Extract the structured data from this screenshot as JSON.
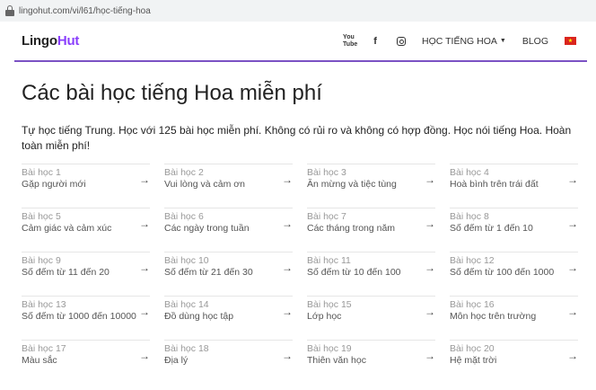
{
  "browser": {
    "url": "lingohut.com/vi/l61/học-tiếng-hoa"
  },
  "header": {
    "logo_part1": "Lingo",
    "logo_part2": "Hut",
    "youtube_icon_text": "You\nTube",
    "facebook_icon_text": "f",
    "menu_label": "HỌC TIẾNG HOA",
    "blog_label": "BLOG",
    "flag_star": "★"
  },
  "main": {
    "title": "Các bài học tiếng Hoa miễn phí",
    "intro": "Tự học tiếng Trung. Học với 125 bài học miễn phí. Không có rủi ro và không có hợp đồng. Học nói tiếng Hoa. Hoàn toàn miễn phí!",
    "arrow": "→",
    "lessons": [
      {
        "num": "Bài học 1",
        "name": "Gặp người mới"
      },
      {
        "num": "Bài học 2",
        "name": "Vui lòng và cảm ơn"
      },
      {
        "num": "Bài học 3",
        "name": "Ăn mừng và tiệc tùng"
      },
      {
        "num": "Bài học 4",
        "name": "Hoà bình trên trái đất"
      },
      {
        "num": "Bài học 5",
        "name": "Cảm giác và cảm xúc"
      },
      {
        "num": "Bài học 6",
        "name": "Các ngày trong tuần"
      },
      {
        "num": "Bài học 7",
        "name": "Các tháng trong năm"
      },
      {
        "num": "Bài học 8",
        "name": "Số đếm từ 1 đến 10"
      },
      {
        "num": "Bài học 9",
        "name": "Số đếm từ 11 đến 20"
      },
      {
        "num": "Bài học 10",
        "name": "Số đếm từ 21 đến 30"
      },
      {
        "num": "Bài học 11",
        "name": "Số đếm từ 10 đến 100"
      },
      {
        "num": "Bài học 12",
        "name": "Số đếm từ 100 đến 1000"
      },
      {
        "num": "Bài học 13",
        "name": "Số đếm từ 1000 đến 10000"
      },
      {
        "num": "Bài học 14",
        "name": "Đồ dùng học tập"
      },
      {
        "num": "Bài học 15",
        "name": "Lớp học"
      },
      {
        "num": "Bài học 16",
        "name": "Môn học trên trường"
      },
      {
        "num": "Bài học 17",
        "name": "Màu sắc"
      },
      {
        "num": "Bài học 18",
        "name": "Địa lý"
      },
      {
        "num": "Bài học 19",
        "name": "Thiên văn học"
      },
      {
        "num": "Bài học 20",
        "name": "Hệ mặt trời"
      }
    ]
  },
  "colors": {
    "accent": "#7b52c4",
    "logo_hut": "#8a3ffc",
    "flag": "#da251d"
  }
}
